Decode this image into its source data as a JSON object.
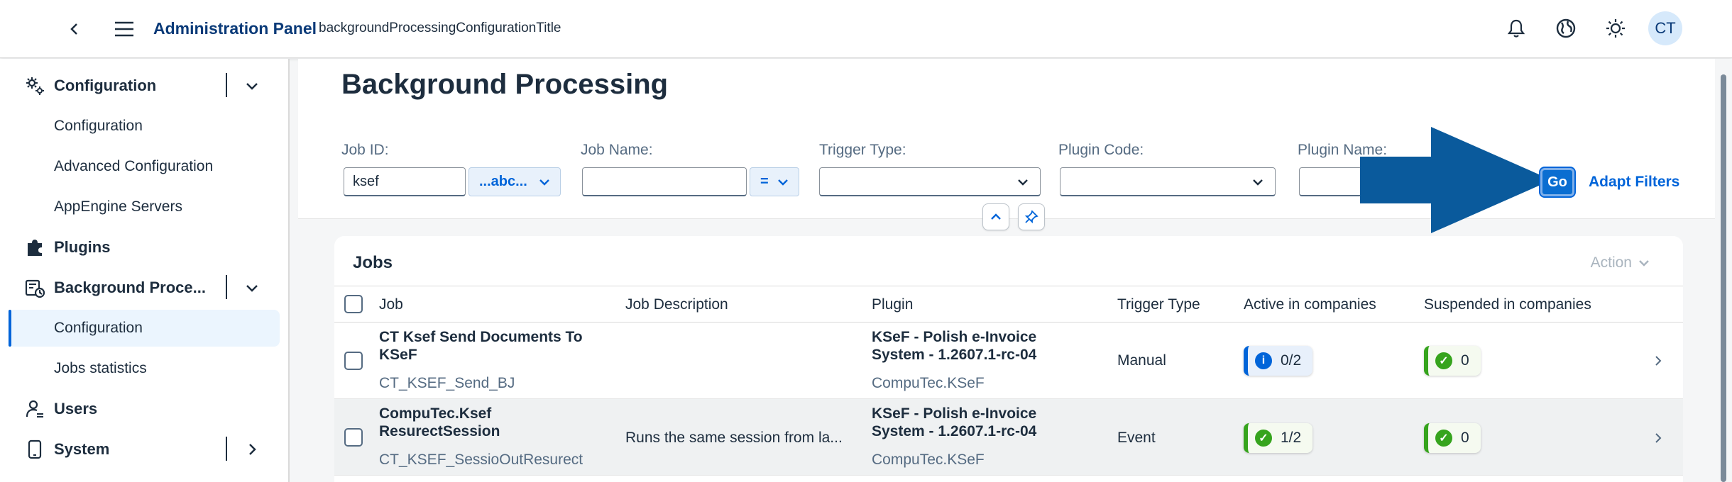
{
  "shell": {
    "title": "Administration Panel",
    "subtitle": "backgroundProcessingConfigurationTitle",
    "avatar_initials": "CT"
  },
  "sidebar": {
    "groups": [
      {
        "label": "Configuration",
        "icon": "gears-icon",
        "expanded": true,
        "items": [
          "Configuration",
          "Advanced Configuration",
          "AppEngine Servers"
        ]
      },
      {
        "label": "Plugins",
        "icon": "puzzle-icon"
      },
      {
        "label": "Background Proce...",
        "icon": "background-process-icon",
        "expanded": true,
        "items": [
          "Configuration",
          "Jobs statistics"
        ],
        "active_item": "Configuration"
      },
      {
        "label": "Users",
        "icon": "user-settings-icon"
      },
      {
        "label": "System",
        "icon": "device-icon",
        "expanded": false
      }
    ]
  },
  "page": {
    "title": "Background Processing"
  },
  "filters": {
    "job_id_label": "Job ID:",
    "job_id_value": "ksef",
    "job_id_operator": "...abc...",
    "job_name_label": "Job Name:",
    "job_name_value": "",
    "job_name_operator": "=",
    "trigger_type_label": "Trigger Type:",
    "plugin_code_label": "Plugin Code:",
    "plugin_name_label": "Plugin Name:",
    "go_label": "Go",
    "adapt_label": "Adapt Filters"
  },
  "table": {
    "title": "Jobs",
    "action_label": "Action",
    "columns": [
      "Job",
      "Job Description",
      "Plugin",
      "Trigger Type",
      "Active in companies",
      "Suspended in companies"
    ],
    "rows": [
      {
        "job_line1": "CT Ksef Send Documents To",
        "job_line2": "KSeF",
        "job_id": "CT_KSEF_Send_BJ",
        "description": "",
        "plugin_line1": "KSeF - Polish e-Invoice",
        "plugin_line2": "System - 1.2607.1-rc-04",
        "plugin_code": "CompuTec.KSeF",
        "trigger": "Manual",
        "active": "0/2",
        "active_status": "info",
        "suspended": "0"
      },
      {
        "job_line1": "CompuTec.Ksef",
        "job_line2": "ResurectSession",
        "job_id": "CT_KSEF_SessioOutResurect",
        "description": "Runs the same session from la...",
        "plugin_line1": "KSeF - Polish e-Invoice",
        "plugin_line2": "System - 1.2607.1-rc-04",
        "plugin_code": "CompuTec.KSeF",
        "trigger": "Event",
        "active": "1/2",
        "active_status": "success",
        "suspended": "0"
      }
    ]
  },
  "colors": {
    "accent": "#0064d9",
    "brand_title": "#0a3a78",
    "success": "#36a41d",
    "annotation_arrow": "#0a5a9c"
  }
}
